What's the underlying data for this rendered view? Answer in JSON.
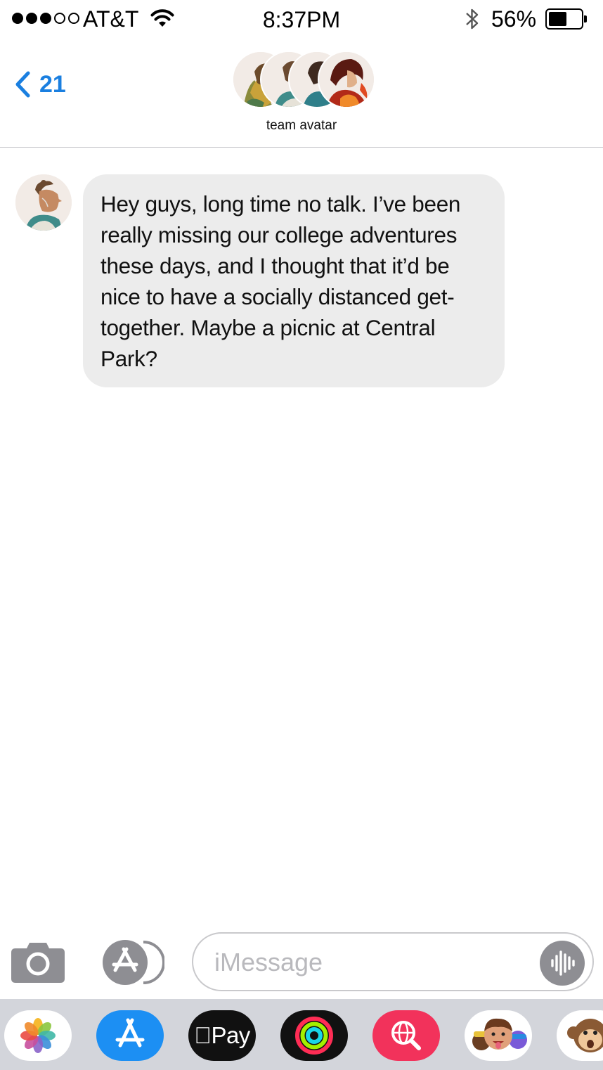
{
  "status_bar": {
    "carrier": "AT&T",
    "time": "8:37PM",
    "battery_percent": "56%",
    "battery_level": 0.56,
    "signal_bars_filled": 3,
    "signal_bars_total": 5,
    "icons": [
      "wifi-icon",
      "bluetooth-icon",
      "battery-icon"
    ]
  },
  "header": {
    "back_count": "21",
    "group_name": "team avatar",
    "member_avatar_count": 4,
    "accent_color": "#1a7fe0"
  },
  "conversation": {
    "messages": [
      {
        "direction": "incoming",
        "text": "Hey guys, long time no talk. I’ve been really missing our college adventures these days, and I thought that it’d be nice to have a socially distanced get-together. Maybe a picnic at Central Park?"
      }
    ]
  },
  "compose": {
    "placeholder": "iMessage",
    "value": ""
  },
  "app_drawer": {
    "apps": [
      {
        "name": "photos",
        "icon": "photos-icon"
      },
      {
        "name": "app-store",
        "icon": "app-store-icon"
      },
      {
        "name": "apple-pay",
        "icon": "apple-pay-icon",
        "label": "Pay"
      },
      {
        "name": "activity",
        "icon": "activity-icon"
      },
      {
        "name": "web-search",
        "icon": "search-globe-icon"
      },
      {
        "name": "memoji",
        "icon": "memoji-icon"
      },
      {
        "name": "animoji",
        "icon": "monkey-icon"
      }
    ]
  }
}
